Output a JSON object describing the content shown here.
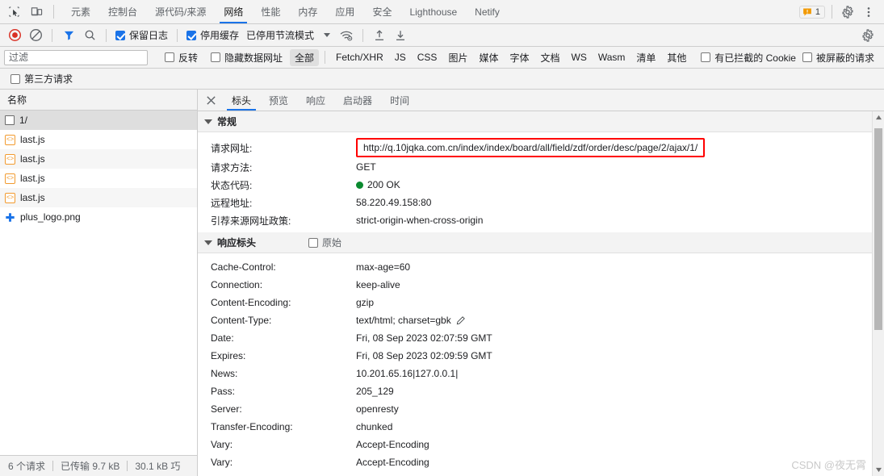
{
  "topbar": {
    "icons": [
      {
        "name": "inspect-element-icon"
      },
      {
        "name": "device-toolbar-icon"
      }
    ],
    "tabs": [
      {
        "label": "元素",
        "active": false
      },
      {
        "label": "控制台",
        "active": false
      },
      {
        "label": "源代码/来源",
        "active": false
      },
      {
        "label": "网络",
        "active": true
      },
      {
        "label": "性能",
        "active": false
      },
      {
        "label": "内存",
        "active": false
      },
      {
        "label": "应用",
        "active": false
      },
      {
        "label": "安全",
        "active": false
      },
      {
        "label": "Lighthouse",
        "active": false
      },
      {
        "label": "Netify",
        "active": false
      }
    ],
    "warning_count": "1",
    "settings_icon": "gear-icon",
    "more_icon": "kebab-menu-icon"
  },
  "network_toolbar": {
    "record_icon": "record-button-icon",
    "clear_icon": "clear-network-log-icon",
    "filter_icon": "filter-icon",
    "search_icon": "search-icon",
    "preserve_log": {
      "label": "保留日志",
      "checked": true
    },
    "disable_cache": {
      "label": "停用缓存",
      "checked": true
    },
    "throttling": {
      "label": "已停用节流模式"
    },
    "throttle_settings_icon": "network-conditions-icon",
    "import_icon": "import-har-icon",
    "export_icon": "export-har-icon",
    "settings_icon": "network-settings-gear-icon"
  },
  "filter_row": {
    "placeholder": "过滤",
    "value": "",
    "invert": {
      "label": "反转",
      "checked": false
    },
    "hide_data_urls": {
      "label": "隐藏数据网址",
      "checked": false
    },
    "types": [
      {
        "label": "全部",
        "active": true
      },
      {
        "label": "Fetch/XHR",
        "active": false
      },
      {
        "label": "JS",
        "active": false
      },
      {
        "label": "CSS",
        "active": false
      },
      {
        "label": "图片",
        "active": false
      },
      {
        "label": "媒体",
        "active": false
      },
      {
        "label": "字体",
        "active": false
      },
      {
        "label": "文档",
        "active": false
      },
      {
        "label": "WS",
        "active": false
      },
      {
        "label": "Wasm",
        "active": false
      },
      {
        "label": "清单",
        "active": false
      },
      {
        "label": "其他",
        "active": false
      }
    ],
    "blocked_cookies": {
      "label": "有已拦截的 Cookie",
      "checked": false
    },
    "blocked_requests": {
      "label": "被屏蔽的请求",
      "checked": false
    }
  },
  "third_party_row": {
    "label": "第三方请求",
    "checked": false
  },
  "request_list": {
    "column_header": "名称",
    "rows": [
      {
        "name": "1/",
        "icon": "document-icon",
        "selected": true
      },
      {
        "name": "last.js",
        "icon": "js-file-icon",
        "selected": false
      },
      {
        "name": "last.js",
        "icon": "js-file-icon",
        "selected": false
      },
      {
        "name": "last.js",
        "icon": "js-file-icon",
        "selected": false
      },
      {
        "name": "last.js",
        "icon": "js-file-icon",
        "selected": false
      },
      {
        "name": "plus_logo.png",
        "icon": "image-file-icon",
        "selected": false
      }
    ]
  },
  "status_bar": {
    "requests": "6 个请求",
    "transferred": "已传输 9.7 kB",
    "resources": "30.1 kB 巧"
  },
  "detail_panel": {
    "close_icon": "close-icon",
    "tabs": [
      {
        "label": "标头",
        "active": true
      },
      {
        "label": "预览",
        "active": false
      },
      {
        "label": "响应",
        "active": false
      },
      {
        "label": "启动器",
        "active": false
      },
      {
        "label": "时间",
        "active": false
      }
    ],
    "general": {
      "title": "常规",
      "rows": [
        {
          "key": "请求网址:",
          "value": "http://q.10jqka.com.cn/index/index/board/all/field/zdf/order/desc/page/2/ajax/1/",
          "highlight": true
        },
        {
          "key": "请求方法:",
          "value": "GET"
        },
        {
          "key": "状态代码:",
          "value": "200 OK",
          "status_dot": "#0a8a2f"
        },
        {
          "key": "远程地址:",
          "value": "58.220.49.158:80"
        },
        {
          "key": "引荐来源网址政策:",
          "value": "strict-origin-when-cross-origin"
        }
      ]
    },
    "response_headers": {
      "title": "响应标头",
      "raw_label": "原始",
      "raw_checked": false,
      "rows": [
        {
          "key": "Cache-Control:",
          "value": "max-age=60"
        },
        {
          "key": "Connection:",
          "value": "keep-alive"
        },
        {
          "key": "Content-Encoding:",
          "value": "gzip"
        },
        {
          "key": "Content-Type:",
          "value": "text/html; charset=gbk",
          "edit_icon": "pencil-edit-icon"
        },
        {
          "key": "Date:",
          "value": "Fri, 08 Sep 2023 02:07:59 GMT"
        },
        {
          "key": "Expires:",
          "value": "Fri, 08 Sep 2023 02:09:59 GMT"
        },
        {
          "key": "News:",
          "value": "10.201.65.16|127.0.0.1|"
        },
        {
          "key": "Pass:",
          "value": "205_129"
        },
        {
          "key": "Server:",
          "value": "openresty"
        },
        {
          "key": "Transfer-Encoding:",
          "value": "chunked"
        },
        {
          "key": "Vary:",
          "value": "Accept-Encoding"
        },
        {
          "key": "Vary:",
          "value": "Accept-Encoding"
        }
      ]
    }
  },
  "watermark": "CSDN @夜无霄",
  "colors": {
    "accent": "#1a73e8",
    "record": "#d93025",
    "highlight_border": "#ff0000",
    "status_ok": "#0a8a2f",
    "js_icon": "#f29a2e"
  }
}
